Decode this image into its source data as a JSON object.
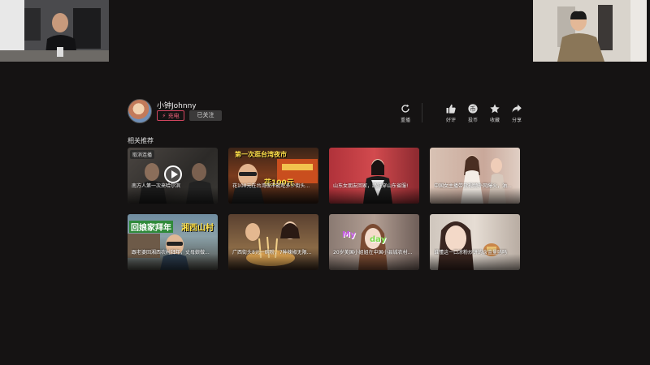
{
  "author": {
    "name": "小钟Johnny",
    "charge_label": "充电",
    "follow_label": "已关注"
  },
  "actions": [
    {
      "label": "重播",
      "icon": "replay-icon"
    },
    {
      "label": "好评",
      "icon": "thumbs-up-icon"
    },
    {
      "label": "投币",
      "icon": "coin-icon"
    },
    {
      "label": "收藏",
      "icon": "star-icon"
    },
    {
      "label": "分享",
      "icon": "share-icon"
    }
  ],
  "section_title": "相关推荐",
  "cancel_label": "取消连播",
  "videos": [
    {
      "caption": "南方人第一次来哈尔滨",
      "overlay": "",
      "overlay2": ""
    },
    {
      "caption": "花100元在台湾夜市能吃多少街头...",
      "overlay": "第一次逛台湾夜市",
      "overlay2": "花100元"
    },
    {
      "caption": "山东女朋友回家，踊跃穿山东省服!",
      "overlay": "",
      "overlay2": ""
    },
    {
      "caption": "中国女主播带货视频外网爆火，油...",
      "overlay": "",
      "overlay2": ""
    },
    {
      "caption": "跟老婆回湘西农村拜年，丈母娘做...",
      "overlay": "回娘家拜年",
      "overlay2": "湘西山村"
    },
    {
      "caption": "广西街头8元一碗粉，7种辣椒无限...",
      "overlay": "",
      "overlay2": ""
    },
    {
      "caption": "20岁美国小姐姐在中国小县城农村...",
      "overlay": "My",
      "overlay2": "day"
    },
    {
      "caption": "谁懂这一口凉粉炒饼的含金量吗吗",
      "overlay": "",
      "overlay2": ""
    }
  ]
}
